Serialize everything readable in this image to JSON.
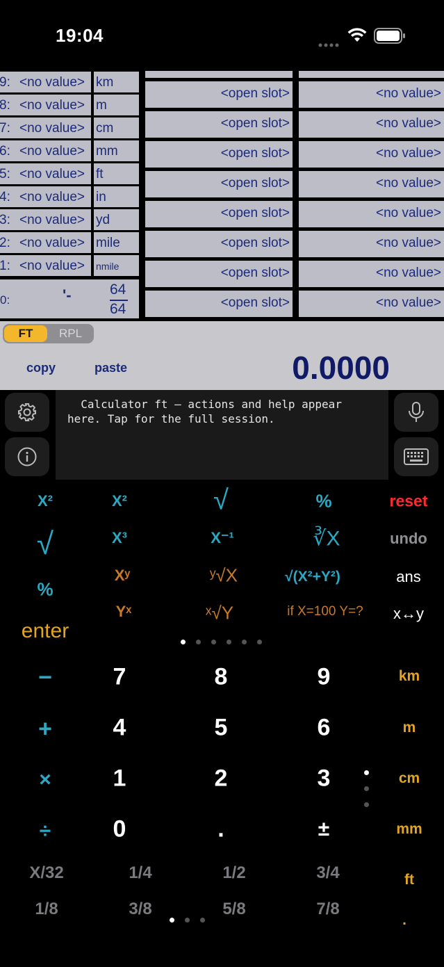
{
  "status": {
    "time": "19:04"
  },
  "registers": [
    {
      "num": "9:",
      "value": "<no value>",
      "unit": "km"
    },
    {
      "num": "8:",
      "value": "<no value>",
      "unit": "m"
    },
    {
      "num": "7:",
      "value": "<no value>",
      "unit": "cm"
    },
    {
      "num": "6:",
      "value": "<no value>",
      "unit": "mm"
    },
    {
      "num": "5:",
      "value": "<no value>",
      "unit": "ft"
    },
    {
      "num": "4:",
      "value": "<no value>",
      "unit": "in"
    },
    {
      "num": "3:",
      "value": "<no value>",
      "unit": "yd"
    },
    {
      "num": "2:",
      "value": "<no value>",
      "unit": "mile"
    },
    {
      "num": "1:",
      "value": "<no value>",
      "unit": "nmile"
    }
  ],
  "register0": {
    "num": "0:",
    "mark": "'-",
    "frac_top": "64",
    "frac_bottom": "64"
  },
  "slots": {
    "label": "<open slot>",
    "value": "<no value>"
  },
  "mode": {
    "ft": "FT",
    "rpl": "RPL"
  },
  "actions": {
    "copy": "copy",
    "paste": "paste"
  },
  "display": "0.0000",
  "help": "  Calculator ft — actions and help appear\nhere. Tap for the full session.",
  "functions": {
    "row1": [
      "X²",
      "X²",
      "√",
      "%",
      "reset"
    ],
    "row2": [
      "√",
      "X³",
      "X⁻¹",
      "∛X",
      "undo"
    ],
    "row3": [
      "%",
      "Xʸ",
      "ʸ√X",
      "√(X²+Y²)",
      "ans"
    ],
    "row4": [
      "enter",
      "Yˣ",
      "ˣ√Y",
      "if X=100 Y=?",
      "x↔y"
    ]
  },
  "keypad": {
    "ops": [
      "−",
      "+",
      "×",
      "÷"
    ],
    "digits": [
      [
        "7",
        "8",
        "9"
      ],
      [
        "4",
        "5",
        "6"
      ],
      [
        "1",
        "2",
        "3"
      ],
      [
        "0",
        ".",
        "±"
      ]
    ],
    "units": [
      "km",
      "m",
      "cm",
      "mm",
      "ft",
      "."
    ]
  },
  "fractions": {
    "row1": [
      "X/32",
      "1/4",
      "1/2",
      "3/4"
    ],
    "row2": [
      "1/8",
      "3/8",
      "5/8",
      "7/8"
    ]
  }
}
